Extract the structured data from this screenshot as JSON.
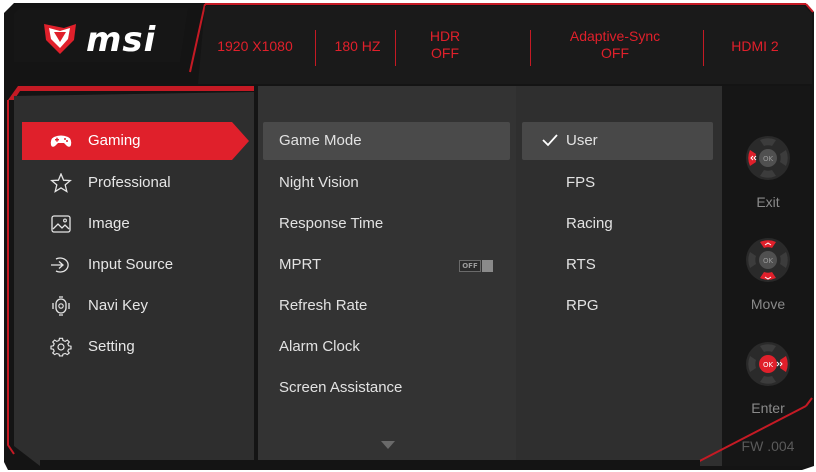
{
  "header": {
    "brand": "msi",
    "status": [
      {
        "label": "1920 X1080",
        "value": ""
      },
      {
        "label": "180 HZ",
        "value": ""
      },
      {
        "label": "HDR",
        "value": "OFF"
      },
      {
        "label": "Adaptive-Sync",
        "value": "OFF"
      },
      {
        "label": "HDMI 2",
        "value": ""
      }
    ]
  },
  "categories": [
    {
      "label": "Gaming",
      "icon": "gamepad-icon",
      "selected": true
    },
    {
      "label": "Professional",
      "icon": "star-icon"
    },
    {
      "label": "Image",
      "icon": "image-icon"
    },
    {
      "label": "Input Source",
      "icon": "input-source-icon"
    },
    {
      "label": "Navi Key",
      "icon": "navi-key-icon"
    },
    {
      "label": "Setting",
      "icon": "gear-icon"
    }
  ],
  "submenu": {
    "items": [
      {
        "label": "Game Mode",
        "selected": true
      },
      {
        "label": "Night Vision"
      },
      {
        "label": "Response Time"
      },
      {
        "label": "MPRT",
        "toggle": "OFF"
      },
      {
        "label": "Refresh Rate"
      },
      {
        "label": "Alarm Clock"
      },
      {
        "label": "Screen Assistance"
      }
    ],
    "scroll_icon": "chevron-down-icon"
  },
  "options": [
    {
      "label": "User",
      "checked": true
    },
    {
      "label": "FPS"
    },
    {
      "label": "Racing"
    },
    {
      "label": "RTS"
    },
    {
      "label": "RPG"
    }
  ],
  "keys": [
    {
      "label": "Exit",
      "center": "OK"
    },
    {
      "label": "Move",
      "center": "OK"
    },
    {
      "label": "Enter",
      "center": "OK"
    }
  ],
  "firmware": "FW .004",
  "colors": {
    "accent": "#e0202b",
    "accent_dark": "#c51a24",
    "panel": "#2b2b2b",
    "panel_alt": "#333333",
    "bezel": "#141414"
  }
}
